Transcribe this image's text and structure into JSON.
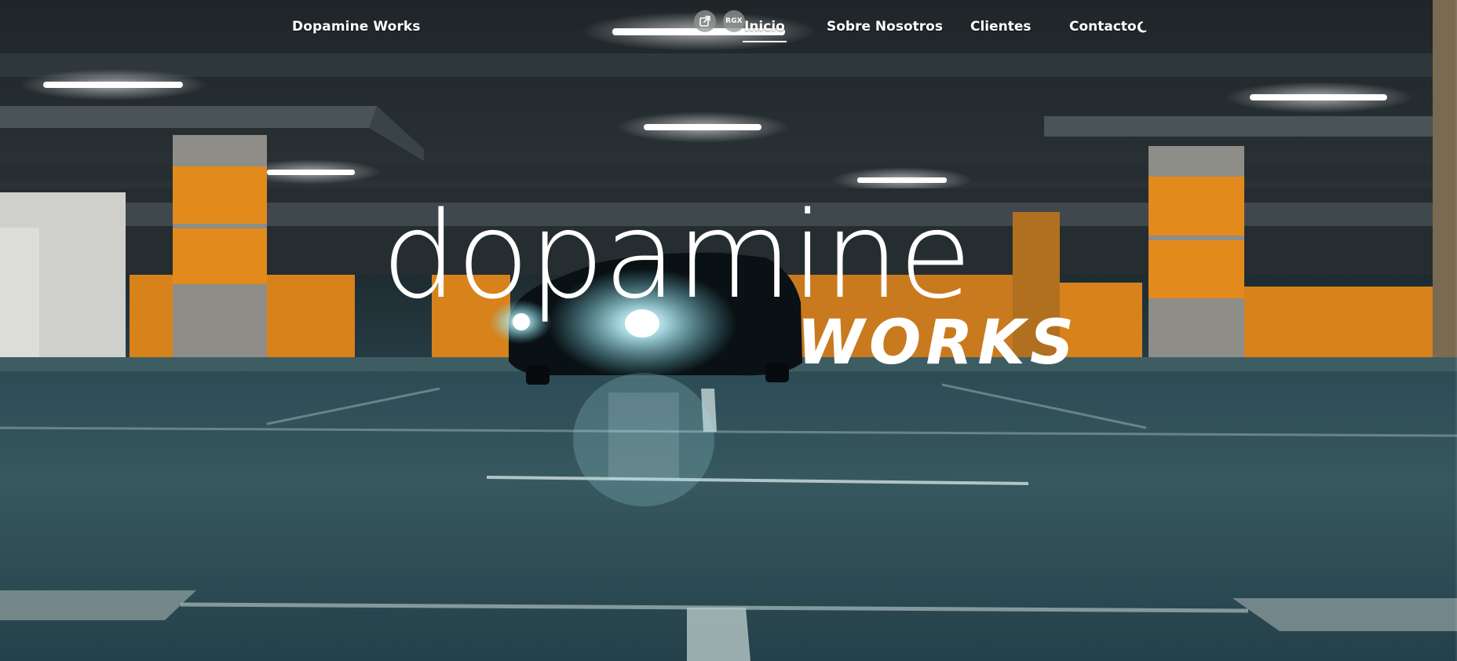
{
  "nav": {
    "brand": "Dopamine Works",
    "links": [
      {
        "label": "Inicio",
        "active": true
      },
      {
        "label": "Sobre Nosotros",
        "active": false
      },
      {
        "label": "Clientes",
        "active": false
      },
      {
        "label": "Contacto",
        "active": false
      }
    ],
    "theme_toggle_icon": "moon-icon"
  },
  "floating_buttons": {
    "external_icon": "external-link-icon",
    "rgx_label": "RGX"
  },
  "hero": {
    "logo_main": "dopamine",
    "logo_sub": "WORKS",
    "background": "night-parking-garage-car-headlights",
    "accent_color": "#e8871c"
  }
}
